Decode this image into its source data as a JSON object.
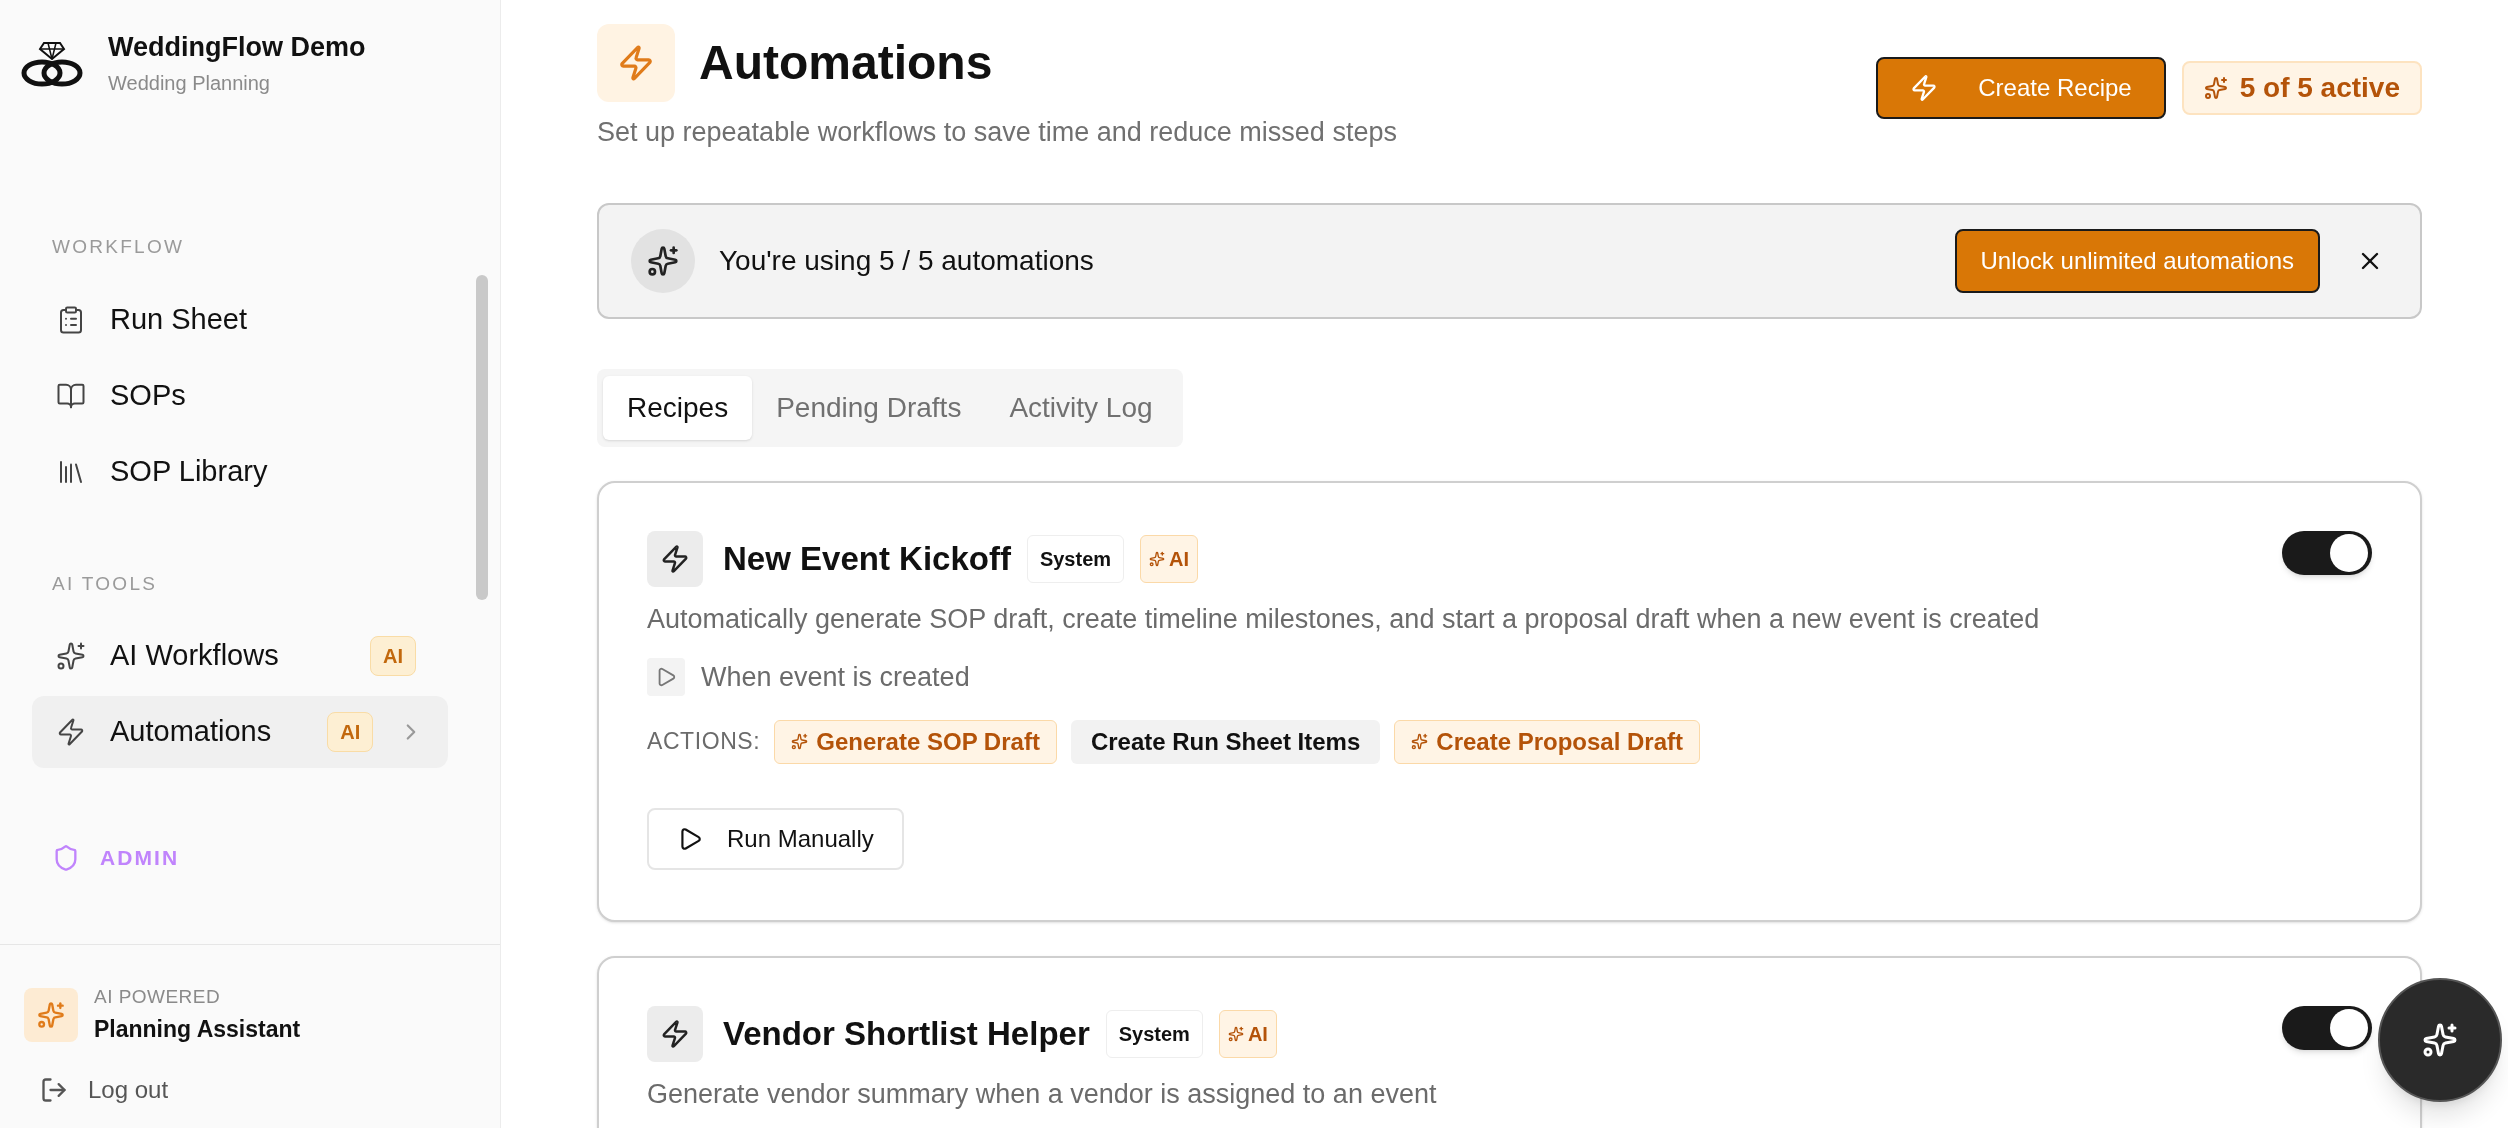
{
  "sidebar": {
    "brand": {
      "title": "WeddingFlow Demo",
      "subtitle": "Wedding Planning"
    },
    "sections": [
      {
        "heading": "WORKFLOW",
        "items": [
          {
            "label": "Run Sheet",
            "kind": "clipboard",
            "selected": false
          },
          {
            "label": "SOPs",
            "kind": "book",
            "selected": false
          },
          {
            "label": "SOP Library",
            "kind": "library",
            "selected": false
          }
        ]
      },
      {
        "heading": "AI TOOLS",
        "items": [
          {
            "label": "AI Workflows",
            "kind": "sparkles",
            "badge": "AI",
            "selected": false
          },
          {
            "label": "Automations",
            "kind": "zap",
            "badge": "AI",
            "selected": true
          }
        ]
      }
    ],
    "admin": "ADMIN",
    "assistant": {
      "caption": "AI POWERED",
      "title": "Planning Assistant"
    },
    "logout": "Log out"
  },
  "header": {
    "title": "Automations",
    "subtitle": "Set up repeatable workflows to save time and reduce missed steps",
    "create_button": "Create Recipe",
    "active_badge": "5 of 5 active"
  },
  "banner": {
    "text": "You're using 5 / 5 automations",
    "button": "Unlock unlimited automations"
  },
  "tabs": [
    {
      "label": "Recipes",
      "selected": true
    },
    {
      "label": "Pending Drafts",
      "selected": false
    },
    {
      "label": "Activity Log",
      "selected": false
    }
  ],
  "recipes": [
    {
      "title": "New Event Kickoff",
      "tags": [
        {
          "label": "System",
          "kind": "system"
        },
        {
          "label": "AI",
          "kind": "ai"
        }
      ],
      "on": true,
      "description": "Automatically generate SOP draft, create timeline milestones, and start a proposal draft when a new event is created",
      "trigger": "When event is created",
      "actions_label": "ACTIONS:",
      "actions": [
        {
          "label": "Generate SOP Draft",
          "kind": "ai"
        },
        {
          "label": "Create Run Sheet Items",
          "kind": "plain"
        },
        {
          "label": "Create Proposal Draft",
          "kind": "ai"
        }
      ],
      "run_button": "Run Manually"
    },
    {
      "title": "Vendor Shortlist Helper",
      "tags": [
        {
          "label": "System",
          "kind": "system"
        },
        {
          "label": "AI",
          "kind": "ai"
        }
      ],
      "on": true,
      "description": "Generate vendor summary when a vendor is assigned to an event"
    }
  ]
}
